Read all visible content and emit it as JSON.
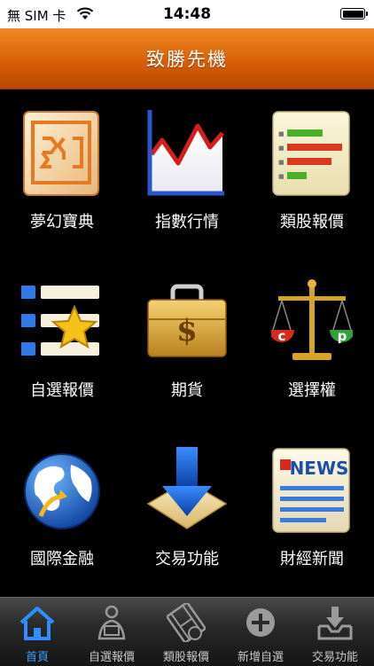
{
  "status_bar": {
    "carrier": "無 SIM 卡",
    "time": "14:48",
    "wifi_icon": "wifi-icon",
    "battery_icon": "battery-icon"
  },
  "header": {
    "title": "致勝先機",
    "colors": {
      "start": "#f28a25",
      "end": "#b84803"
    }
  },
  "menu": {
    "items": [
      {
        "label": "夢幻寶典",
        "icon": "dream-book-icon"
      },
      {
        "label": "指數行情",
        "icon": "index-chart-icon"
      },
      {
        "label": "類股報價",
        "icon": "sector-bars-icon"
      },
      {
        "label": "自選報價",
        "icon": "watchlist-star-icon"
      },
      {
        "label": "期貨",
        "icon": "futures-briefcase-icon"
      },
      {
        "label": "選擇權",
        "icon": "options-scale-icon"
      },
      {
        "label": "國際金融",
        "icon": "globe-icon"
      },
      {
        "label": "交易功能",
        "icon": "trade-arrow-icon"
      },
      {
        "label": "財經新聞",
        "icon": "news-icon"
      }
    ]
  },
  "news_icon_text": "NEWS",
  "options_icon_letters": {
    "left": "c",
    "right": "p"
  },
  "futures_icon_symbol": "$",
  "tab_bar": {
    "active_color": "#3da0ff",
    "tabs": [
      {
        "label": "首頁",
        "icon": "home-icon",
        "active": true
      },
      {
        "label": "自選報價",
        "icon": "person-watchlist-icon",
        "active": false
      },
      {
        "label": "類股報價",
        "icon": "film-strip-icon",
        "active": false
      },
      {
        "label": "新增自選",
        "icon": "add-circle-icon",
        "active": false
      },
      {
        "label": "交易功能",
        "icon": "download-tray-icon",
        "active": false
      }
    ]
  }
}
